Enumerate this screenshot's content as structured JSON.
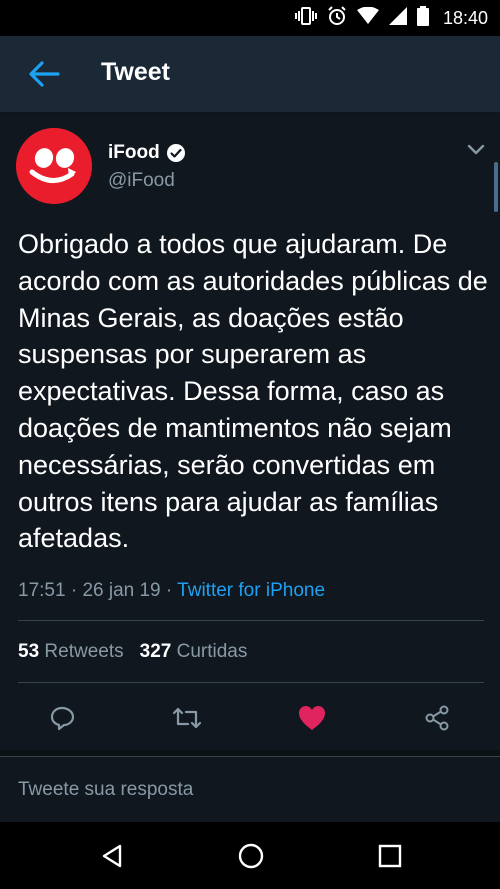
{
  "status_bar": {
    "time": "18:40"
  },
  "header": {
    "title": "Tweet"
  },
  "tweet": {
    "author_name": "iFood",
    "author_handle": "@iFood",
    "text": "Obrigado a todos que ajudaram. De acordo com as autoridades públicas de Minas Gerais, as doações estão suspensas por superarem as expectativas. Dessa forma, caso as doações de mantimentos não sejam necessárias, serão convertidas em outros itens para ajudar as famílias afetadas.",
    "time": "17:51",
    "date": "26 jan 19",
    "source": "Twitter for iPhone",
    "retweets_count": "53",
    "retweets_label": "Retweets",
    "likes_count": "327",
    "likes_label": "Curtidas"
  },
  "reply": {
    "placeholder": "Tweete sua resposta"
  },
  "colors": {
    "accent": "#1da1f2",
    "like": "#e0245e",
    "background": "#10171e",
    "header": "#1b2836",
    "brand": "#ea1d2c"
  }
}
